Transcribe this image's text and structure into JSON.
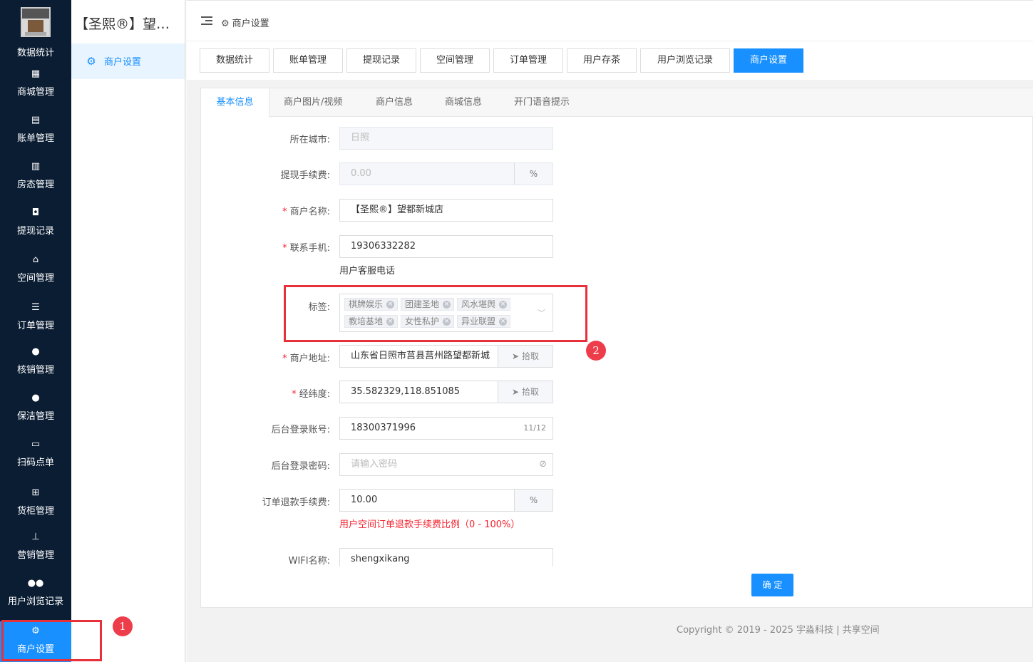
{
  "sidebar": {
    "first_label": "数据统计",
    "items": [
      {
        "icon": "shop-icon",
        "glyph": "🏬",
        "label": "商城管理"
      },
      {
        "icon": "bill-icon",
        "glyph": "▤",
        "label": "账单管理"
      },
      {
        "icon": "building-icon",
        "glyph": "▥",
        "label": "房态管理"
      },
      {
        "icon": "money-icon",
        "glyph": "◘",
        "label": "提现记录"
      },
      {
        "icon": "home-icon",
        "glyph": "⌂",
        "label": "空间管理"
      },
      {
        "icon": "list-icon",
        "glyph": "☰",
        "label": "订单管理"
      },
      {
        "icon": "user-check-icon",
        "glyph": "👤",
        "label": "核销管理"
      },
      {
        "icon": "user-clock-icon",
        "glyph": "👤",
        "label": "保洁管理"
      },
      {
        "icon": "store-icon",
        "glyph": "▭",
        "label": "扫码点单"
      },
      {
        "icon": "grid-icon",
        "glyph": "▦",
        "label": "货柜管理"
      },
      {
        "icon": "sitemap-icon",
        "glyph": "⊥",
        "label": "营销管理"
      },
      {
        "icon": "users-icon",
        "glyph": "👥",
        "label": "用户浏览记录"
      },
      {
        "icon": "gear-icon",
        "glyph": "⚙",
        "label": "商户设置"
      }
    ]
  },
  "subnav": {
    "store_title": "【圣熙®】望都新城店",
    "item_label": "商户设置"
  },
  "header": {
    "breadcrumb": "商户设置"
  },
  "top_tabs": [
    "数据统计",
    "账单管理",
    "提现记录",
    "空间管理",
    "订单管理",
    "用户存茶",
    "用户浏览记录",
    "商户设置"
  ],
  "inner_tabs": [
    "基本信息",
    "商户图片/视频",
    "商户信息",
    "商城信息",
    "开门语音提示"
  ],
  "form": {
    "city_label": "所在城市:",
    "city_value": "日照",
    "fee_label": "提现手续费:",
    "fee_value": "0.00",
    "percent": "%",
    "name_label": "商户名称:",
    "name_value": "【圣熙®】望都新城店",
    "phone_label": "联系手机:",
    "phone_value": "19306332282",
    "phone_hint": "用户客服电话",
    "tags_label": "标签:",
    "tags": [
      "棋牌娱乐",
      "团建圣地",
      "风水堪舆",
      "教培基地",
      "女性私护",
      "异业联盟"
    ],
    "address_label": "商户地址:",
    "address_value": "山东省日照市莒县莒州路望都新城",
    "pick_label": "拾取",
    "latlng_label": "经纬度:",
    "latlng_value": "35.582329,118.851085",
    "account_label": "后台登录账号:",
    "account_value": "18300371996",
    "account_count": "11/12",
    "password_label": "后台登录密码:",
    "password_placeholder": "请输入密码",
    "refund_label": "订单退款手续费:",
    "refund_value": "10.00",
    "refund_hint": "用户空间订单退款手续费比例（0 - 100%）",
    "wifi_label": "WIFI名称:",
    "wifi_value": "shengxikang",
    "submit_label": "确 定"
  },
  "annotations": [
    "1",
    "2"
  ],
  "footer": {
    "copyright": "Copyright © 2019 - 2025 宇淼科技 | 共享空间"
  },
  "colors": {
    "sidebar_bg": "#0b1d33",
    "accent": "#1890ff",
    "highlight_red": "#e8303a"
  }
}
